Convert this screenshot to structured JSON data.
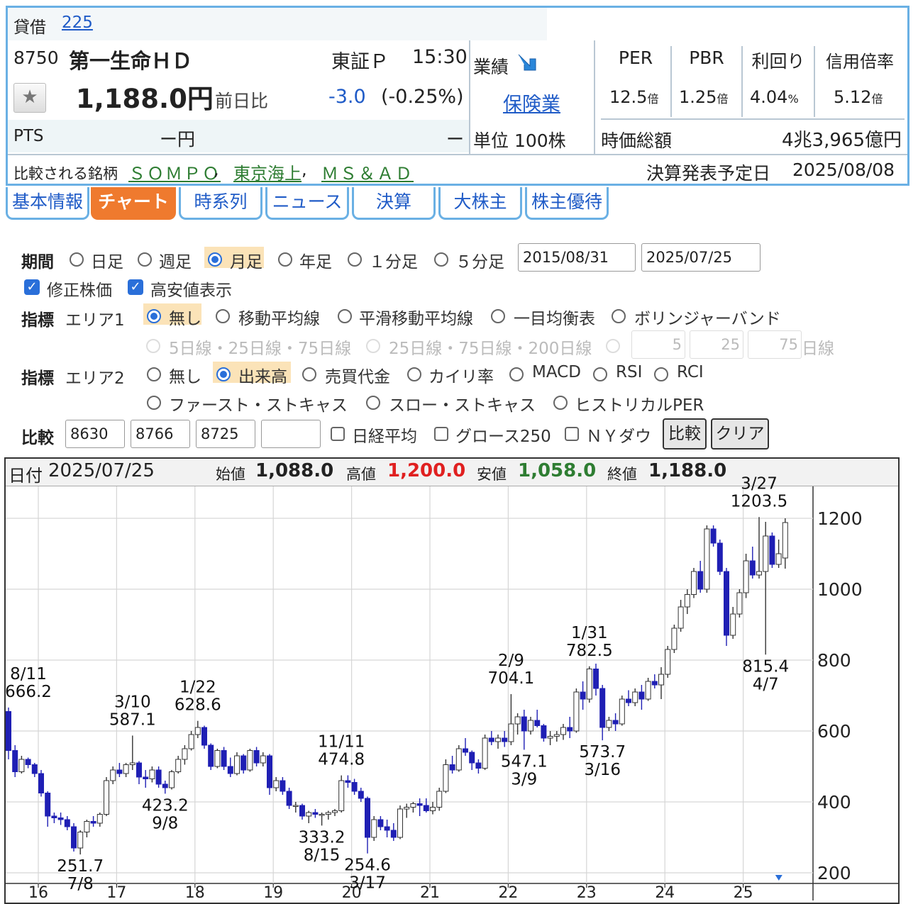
{
  "header": {
    "lending_label": "貸借",
    "lending_code": "225",
    "stock_code": "8750",
    "stock_name": "第一生命ＨＤ",
    "market": "東証Ｐ",
    "time": "15:30",
    "price": "1,188.0円",
    "change_label": "前日比",
    "change": "-3.0",
    "change_pct": "(-0.25%)",
    "pts_label": "PTS",
    "pts_value": "ー円",
    "pts_change": "ー",
    "performance_label": "業績",
    "sector": "保険業",
    "unit": "単位 100株",
    "metrics": [
      {
        "label": "PER",
        "value": "12.5",
        "unit": "倍"
      },
      {
        "label": "PBR",
        "value": "1.25",
        "unit": "倍"
      },
      {
        "label": "利回り",
        "value": "4.04",
        "unit": "%"
      },
      {
        "label": "信用倍率",
        "value": "5.12",
        "unit": "倍"
      }
    ],
    "market_cap_label": "時価総額",
    "market_cap": "4兆3,965億円",
    "compare_label": "比較される銘柄",
    "compare_stocks": [
      "ＳＯＭＰＯ",
      "東京海上",
      "ＭＳ＆ＡＤ"
    ],
    "earnings_label": "決算発表予定日",
    "earnings_date": "2025/08/08"
  },
  "tabs": [
    "基本情報",
    "チャート",
    "時系列",
    "ニュース",
    "決算",
    "大株主",
    "株主優待"
  ],
  "active_tab": "チャート",
  "controls": {
    "period_label": "期間",
    "period_options": [
      "日足",
      "週足",
      "月足",
      "年足",
      "１分足",
      "５分足"
    ],
    "period_selected": "月足",
    "date_from": "2015/08/31",
    "date_to": "2025/07/25",
    "adjusted_label": "修正株価",
    "highlow_label": "高安値表示",
    "indicator_label": "指標",
    "area1_label": "エリア1",
    "area1_options": [
      "無し",
      "移動平均線",
      "平滑移動平均線",
      "一目均衡表",
      "ボリンジャーバンド"
    ],
    "area1_selected": "無し",
    "ma_options": [
      "5日線・25日線・75日線",
      "25日線・75日線・200日線"
    ],
    "ma_inputs": [
      "5",
      "25",
      "75"
    ],
    "ma_unit": "日線",
    "area2_label": "エリア2",
    "area2_options_row1": [
      "無し",
      "出来高",
      "売買代金",
      "カイリ率",
      "MACD",
      "RSI",
      "RCI"
    ],
    "area2_options_row2": [
      "ファースト・ストキャス",
      "スロー・ストキャス",
      "ヒストリカルPER"
    ],
    "area2_selected": "出来高",
    "compare_label": "比較",
    "compare_codes": [
      "8630",
      "8766",
      "8725",
      ""
    ],
    "compare_checks": [
      "日経平均",
      "グロース250",
      "ＮＹダウ"
    ],
    "compare_button": "比較",
    "clear_button": "クリア"
  },
  "chart_info": {
    "date_label": "日付",
    "date": "2025/07/25",
    "open_label": "始値",
    "open": "1,088.0",
    "high_label": "高値",
    "high": "1,200.0",
    "low_label": "安値",
    "low": "1,058.0",
    "close_label": "終値",
    "close": "1,188.0"
  },
  "colors": {
    "up": "#ffffff",
    "down": "#1f1fb4",
    "high_text": "#e02020",
    "low_text": "#2e7d32",
    "accent": "#ef7a2e",
    "border": "#6ab0e4"
  },
  "chart_data": {
    "type": "candlestick",
    "title": "",
    "ylim": [
      170,
      1290
    ],
    "y_ticks": [
      200,
      400,
      600,
      800,
      1000,
      1200
    ],
    "x_ticks": [
      "16",
      "17",
      "18",
      "19",
      "20",
      "21",
      "22",
      "23",
      "24",
      "25"
    ],
    "x_tick_year": [
      2016,
      2017,
      2018,
      2019,
      2020,
      2021,
      2022,
      2023,
      2024,
      2025
    ],
    "start": "2015-08",
    "grid": true,
    "candles": [
      [
        "2015-08",
        655,
        666.2,
        520,
        545
      ],
      [
        "2015-09",
        545,
        560,
        470,
        485
      ],
      [
        "2015-10",
        485,
        530,
        480,
        520
      ],
      [
        "2015-11",
        520,
        525,
        495,
        505
      ],
      [
        "2015-12",
        505,
        510,
        470,
        480
      ],
      [
        "2016-01",
        480,
        490,
        415,
        425
      ],
      [
        "2016-02",
        425,
        430,
        330,
        360
      ],
      [
        "2016-03",
        360,
        370,
        340,
        355
      ],
      [
        "2016-04",
        355,
        370,
        335,
        350
      ],
      [
        "2016-05",
        350,
        360,
        320,
        330
      ],
      [
        "2016-06",
        330,
        340,
        260,
        270
      ],
      [
        "2016-07",
        270,
        320,
        251.7,
        315
      ],
      [
        "2016-08",
        315,
        350,
        300,
        345
      ],
      [
        "2016-09",
        345,
        360,
        330,
        340
      ],
      [
        "2016-10",
        340,
        370,
        330,
        365
      ],
      [
        "2016-11",
        365,
        470,
        360,
        460
      ],
      [
        "2016-12",
        460,
        500,
        450,
        490
      ],
      [
        "2017-01",
        490,
        510,
        470,
        480
      ],
      [
        "2017-02",
        480,
        510,
        470,
        505
      ],
      [
        "2017-03",
        505,
        587.1,
        490,
        510
      ],
      [
        "2017-04",
        510,
        515,
        450,
        470
      ],
      [
        "2017-05",
        470,
        490,
        440,
        465
      ],
      [
        "2017-06",
        465,
        500,
        455,
        490
      ],
      [
        "2017-07",
        490,
        500,
        440,
        450
      ],
      [
        "2017-08",
        450,
        460,
        423.2,
        440
      ],
      [
        "2017-09",
        440,
        490,
        435,
        485
      ],
      [
        "2017-10",
        485,
        530,
        480,
        520
      ],
      [
        "2017-11",
        520,
        560,
        505,
        550
      ],
      [
        "2017-12",
        550,
        600,
        545,
        590
      ],
      [
        "2018-01",
        590,
        628.6,
        580,
        610
      ],
      [
        "2018-02",
        610,
        615,
        550,
        560
      ],
      [
        "2018-03",
        560,
        565,
        490,
        500
      ],
      [
        "2018-04",
        500,
        550,
        495,
        545
      ],
      [
        "2018-05",
        545,
        555,
        490,
        500
      ],
      [
        "2018-06",
        500,
        525,
        470,
        480
      ],
      [
        "2018-07",
        480,
        540,
        475,
        530
      ],
      [
        "2018-08",
        530,
        535,
        480,
        490
      ],
      [
        "2018-09",
        490,
        550,
        485,
        545
      ],
      [
        "2018-10",
        545,
        555,
        500,
        510
      ],
      [
        "2018-11",
        510,
        540,
        500,
        530
      ],
      [
        "2018-12",
        530,
        535,
        420,
        440
      ],
      [
        "2019-01",
        440,
        470,
        430,
        460
      ],
      [
        "2019-02",
        460,
        470,
        420,
        430
      ],
      [
        "2019-03",
        430,
        440,
        380,
        390
      ],
      [
        "2019-04",
        390,
        400,
        370,
        390
      ],
      [
        "2019-05",
        390,
        395,
        350,
        360
      ],
      [
        "2019-06",
        360,
        375,
        340,
        370
      ],
      [
        "2019-07",
        370,
        380,
        355,
        365
      ],
      [
        "2019-08",
        365,
        370,
        333.2,
        365
      ],
      [
        "2019-09",
        365,
        375,
        350,
        370
      ],
      [
        "2019-10",
        370,
        380,
        360,
        375
      ],
      [
        "2019-11",
        375,
        474.8,
        370,
        460
      ],
      [
        "2019-12",
        460,
        475,
        440,
        455
      ],
      [
        "2020-01",
        455,
        465,
        420,
        430
      ],
      [
        "2020-02",
        430,
        440,
        400,
        410
      ],
      [
        "2020-03",
        410,
        415,
        254.6,
        300
      ],
      [
        "2020-04",
        300,
        360,
        290,
        350
      ],
      [
        "2020-05",
        350,
        360,
        320,
        330
      ],
      [
        "2020-06",
        330,
        350,
        300,
        320
      ],
      [
        "2020-07",
        320,
        340,
        290,
        300
      ],
      [
        "2020-08",
        300,
        390,
        295,
        380
      ],
      [
        "2020-09",
        380,
        395,
        355,
        385
      ],
      [
        "2020-10",
        385,
        400,
        370,
        395
      ],
      [
        "2020-11",
        395,
        410,
        360,
        390
      ],
      [
        "2020-12",
        390,
        410,
        370,
        375
      ],
      [
        "2021-01",
        375,
        400,
        365,
        385
      ],
      [
        "2021-02",
        385,
        440,
        375,
        430
      ],
      [
        "2021-03",
        430,
        520,
        425,
        505
      ],
      [
        "2021-04",
        505,
        530,
        480,
        490
      ],
      [
        "2021-05",
        490,
        560,
        485,
        550
      ],
      [
        "2021-06",
        550,
        580,
        530,
        540
      ],
      [
        "2021-07",
        540,
        545,
        490,
        510
      ],
      [
        "2021-08",
        510,
        520,
        480,
        495
      ],
      [
        "2021-09",
        495,
        590,
        490,
        580
      ],
      [
        "2021-10",
        580,
        600,
        560,
        570
      ],
      [
        "2021-11",
        570,
        590,
        550,
        580
      ],
      [
        "2021-12",
        580,
        600,
        555,
        570
      ],
      [
        "2022-01",
        570,
        704.1,
        560,
        620
      ],
      [
        "2022-02",
        620,
        650,
        590,
        640
      ],
      [
        "2022-03",
        640,
        660,
        547.1,
        600
      ],
      [
        "2022-04",
        600,
        640,
        590,
        630
      ],
      [
        "2022-05",
        630,
        660,
        610,
        615
      ],
      [
        "2022-06",
        615,
        620,
        570,
        580
      ],
      [
        "2022-07",
        580,
        600,
        560,
        585
      ],
      [
        "2022-08",
        585,
        600,
        570,
        590
      ],
      [
        "2022-09",
        590,
        620,
        575,
        610
      ],
      [
        "2022-10",
        610,
        640,
        580,
        600
      ],
      [
        "2022-11",
        600,
        720,
        595,
        710
      ],
      [
        "2022-12",
        710,
        740,
        660,
        690
      ],
      [
        "2023-01",
        690,
        782.5,
        680,
        775
      ],
      [
        "2023-02",
        775,
        790,
        700,
        720
      ],
      [
        "2023-03",
        720,
        730,
        573.7,
        610
      ],
      [
        "2023-04",
        610,
        640,
        600,
        630
      ],
      [
        "2023-05",
        630,
        650,
        600,
        620
      ],
      [
        "2023-06",
        620,
        700,
        615,
        690
      ],
      [
        "2023-07",
        690,
        715,
        670,
        680
      ],
      [
        "2023-08",
        680,
        720,
        670,
        710
      ],
      [
        "2023-09",
        710,
        730,
        660,
        690
      ],
      [
        "2023-10",
        690,
        750,
        685,
        740
      ],
      [
        "2023-11",
        740,
        760,
        720,
        730
      ],
      [
        "2023-12",
        730,
        780,
        690,
        760
      ],
      [
        "2024-01",
        760,
        840,
        750,
        830
      ],
      [
        "2024-02",
        830,
        900,
        820,
        890
      ],
      [
        "2024-03",
        890,
        970,
        880,
        950
      ],
      [
        "2024-04",
        950,
        1000,
        930,
        985
      ],
      [
        "2024-05",
        985,
        1060,
        975,
        1050
      ],
      [
        "2024-06",
        1050,
        1080,
        990,
        1000
      ],
      [
        "2024-07",
        1000,
        1180,
        990,
        1170
      ],
      [
        "2024-08",
        1170,
        1180,
        1120,
        1130
      ],
      [
        "2024-09",
        1130,
        1140,
        1040,
        1050
      ],
      [
        "2024-10",
        1050,
        1060,
        840,
        870
      ],
      [
        "2024-11",
        870,
        950,
        860,
        930
      ],
      [
        "2024-12",
        930,
        1000,
        920,
        990
      ],
      [
        "2025-01",
        990,
        1100,
        975,
        1080
      ],
      [
        "2025-02",
        1080,
        1120,
        1030,
        1040
      ],
      [
        "2025-03",
        1040,
        1203.5,
        1030,
        1050
      ],
      [
        "2025-04",
        1050,
        1190,
        815.4,
        1150
      ],
      [
        "2025-05",
        1150,
        1160,
        1060,
        1070
      ],
      [
        "2025-06",
        1070,
        1140,
        1060,
        1100
      ],
      [
        "2025-07",
        1088,
        1200,
        1058,
        1188
      ]
    ],
    "annotations": [
      {
        "date": "8/11",
        "value": "666.2",
        "pos": "above"
      },
      {
        "date": "7/8",
        "value": "251.7",
        "pos": "below"
      },
      {
        "date": "3/10",
        "value": "587.1",
        "pos": "above"
      },
      {
        "date": "9/8",
        "value": "423.2",
        "pos": "below"
      },
      {
        "date": "1/22",
        "value": "628.6",
        "pos": "above"
      },
      {
        "date": "8/15",
        "value": "333.2",
        "pos": "below"
      },
      {
        "date": "11/11",
        "value": "474.8",
        "pos": "above"
      },
      {
        "date": "3/17",
        "value": "254.6",
        "pos": "below"
      },
      {
        "date": "3/9",
        "value": "547.1",
        "pos": "below"
      },
      {
        "date": "2/9",
        "value": "704.1",
        "pos": "above"
      },
      {
        "date": "1/31",
        "value": "782.5",
        "pos": "above"
      },
      {
        "date": "3/16",
        "value": "573.7",
        "pos": "below"
      },
      {
        "date": "3/27",
        "value": "1203.5",
        "pos": "above"
      },
      {
        "date": "4/7",
        "value": "815.4",
        "pos": "below"
      }
    ]
  }
}
